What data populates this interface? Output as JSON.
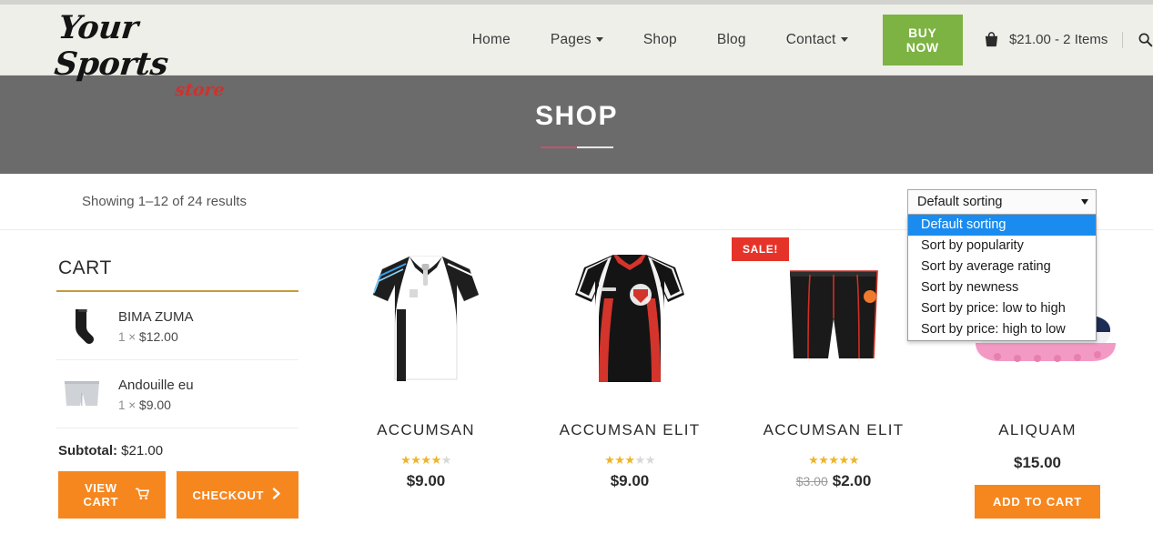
{
  "header": {
    "logo_main": "Your Sports",
    "logo_sub": "store",
    "nav": [
      {
        "label": "Home",
        "has_caret": false
      },
      {
        "label": "Pages",
        "has_caret": true
      },
      {
        "label": "Shop",
        "has_caret": false
      },
      {
        "label": "Blog",
        "has_caret": false
      },
      {
        "label": "Contact",
        "has_caret": true
      }
    ],
    "buy_now_label": "BUY NOW",
    "buy_now_color": "#7cb342",
    "cart_summary": "$21.00 - 2 Items",
    "bag_icon": "shopping-bag-icon",
    "search_icon": "search-icon",
    "background": "#efefea"
  },
  "banner": {
    "title": "SHOP",
    "background": "#6b6b6b",
    "rule_left_color": "#c2546a",
    "rule_right_color": "#e8e8e8"
  },
  "toolbar": {
    "results_text": "Showing 1–12 of 24 results",
    "sort": {
      "selected": "Default sorting",
      "expanded": true,
      "highlight_color": "#1a8cf0",
      "options": [
        "Default sorting",
        "Sort by popularity",
        "Sort by average rating",
        "Sort by newness",
        "Sort by price: low to high",
        "Sort by price: high to low"
      ]
    }
  },
  "cart": {
    "heading": "CART",
    "underline_color": "#c79a3c",
    "items": [
      {
        "name": "BIMA ZUMA",
        "qty": "1 ×",
        "price": "$12.00",
        "thumb": "black-sock-icon"
      },
      {
        "name": "Andouille eu",
        "qty": "1 ×",
        "price": "$9.00",
        "thumb": "gray-shorts-icon"
      }
    ],
    "subtotal_label": "Subtotal:",
    "subtotal_value": "$21.00",
    "view_cart_label": "VIEW CART",
    "checkout_label": "CHECKOUT",
    "button_color": "#f6871f"
  },
  "products": [
    {
      "title": "ACCUMSAN",
      "price": "$9.00",
      "old_price": "",
      "rating_filled": 4,
      "rating_total": 5,
      "sale": false,
      "sale_label": "",
      "image": "white-black-polo-shirt",
      "add_to_cart_label": ""
    },
    {
      "title": "ACCUMSAN ELIT",
      "price": "$9.00",
      "old_price": "",
      "rating_filled": 3,
      "rating_total": 5,
      "sale": false,
      "sale_label": "",
      "image": "black-red-rugby-jersey",
      "add_to_cart_label": ""
    },
    {
      "title": "ACCUMSAN ELIT",
      "price": "$2.00",
      "old_price": "$3.00",
      "rating_filled": 5,
      "rating_total": 5,
      "sale": true,
      "sale_label": "SALE!",
      "image": "black-red-compression-shorts",
      "add_to_cart_label": ""
    },
    {
      "title": "ALIQUAM",
      "price": "$15.00",
      "old_price": "",
      "rating_filled": 0,
      "rating_total": 0,
      "sale": false,
      "sale_label": "",
      "image": "navy-pink-running-shoe",
      "add_to_cart_label": "ADD TO CART"
    }
  ]
}
